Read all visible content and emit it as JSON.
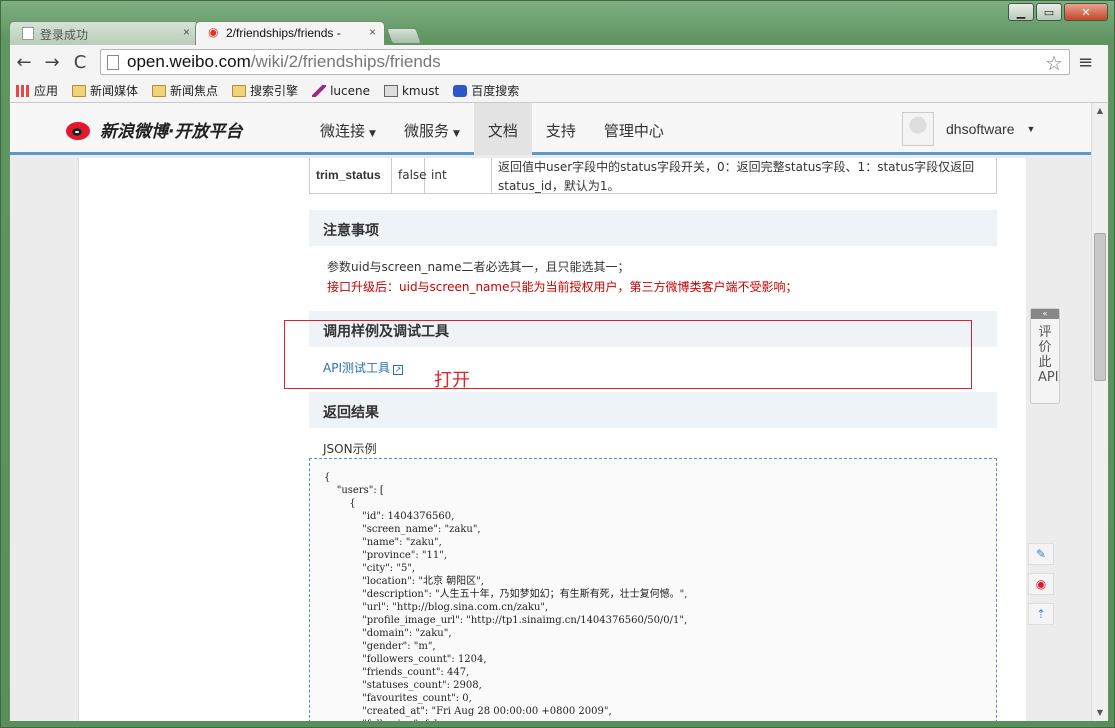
{
  "window": {
    "min": "▁",
    "max": "▭",
    "close": "✕"
  },
  "tabs": [
    {
      "label": "登录成功",
      "close": "×"
    },
    {
      "label": "2/friendships/friends - ",
      "close": "×"
    }
  ],
  "toolbar": {
    "back": "←",
    "forward": "→",
    "reload": "C",
    "url_host": "open.weibo.com",
    "url_path": "/wiki/2/friendships/friends",
    "star": "☆",
    "menu": "≡"
  },
  "bookmarks": [
    "应用",
    "新闻媒体",
    "新闻焦点",
    "搜索引擎",
    "lucene",
    "kmust",
    "百度搜索"
  ],
  "site": {
    "logo": "新浪微博·开放平台",
    "nav": [
      {
        "label": "微连接",
        "caret": "▼"
      },
      {
        "label": "微服务",
        "caret": "▼"
      },
      {
        "label": "文档",
        "caret": ""
      },
      {
        "label": "支持",
        "caret": ""
      },
      {
        "label": "管理中心",
        "caret": ""
      }
    ],
    "username": "dhsoftware",
    "user_caret": "▼"
  },
  "params_row": {
    "name": "trim_status",
    "required": "false",
    "type": "int",
    "desc": "返回值中user字段中的status字段开关，0：返回完整status字段、1：status字段仅返回status_id，默认为1。"
  },
  "notice": {
    "title": "注意事项",
    "line1": "参数uid与screen_name二者必选其一，且只能选其一；",
    "line2": "接口升级后：uid与screen_name只能为当前授权用户，第三方微博类客户端不受影响；"
  },
  "examples": {
    "title": "调用样例及调试工具",
    "link": "API测试工具",
    "open_mark": "打开"
  },
  "result": {
    "title": "返回结果",
    "json_label": "JSON示例",
    "json": "{\n    \"users\": [\n        {\n            \"id\": 1404376560,\n            \"screen_name\": \"zaku\",\n            \"name\": \"zaku\",\n            \"province\": \"11\",\n            \"city\": \"5\",\n            \"location\": \"北京 朝阳区\",\n            \"description\": \"人生五十年，乃如梦如幻；有生斯有死，壮士复何憾。\",\n            \"url\": \"http://blog.sina.com.cn/zaku\",\n            \"profile_image_url\": \"http://tp1.sinaimg.cn/1404376560/50/0/1\",\n            \"domain\": \"zaku\",\n            \"gender\": \"m\",\n            \"followers_count\": 1204,\n            \"friends_count\": 447,\n            \"statuses_count\": 2908,\n            \"favourites_count\": 0,\n            \"created_at\": \"Fri Aug 28 00:00:00 +0800 2009\",\n            \"following\": false,"
  },
  "feedback": {
    "collapse": "«",
    "label": "评价此API"
  },
  "side_tools": {
    "edit": "✎",
    "weibo": "◉",
    "top": "⇡"
  },
  "scrollbar": {
    "up": "▲",
    "down": "▼"
  }
}
